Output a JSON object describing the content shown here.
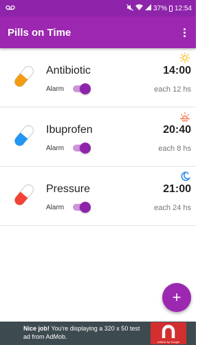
{
  "status_bar": {
    "left_icon": "voicemail-icon",
    "battery_percent": "37%",
    "time": "12:54"
  },
  "app_bar": {
    "title": "Pills on Time"
  },
  "pills": [
    {
      "name": "Antibiotic",
      "alarm_label": "Alarm",
      "alarm_on": true,
      "time": "14:00",
      "frequency": "each 12 hs",
      "period_icon": "sun-icon",
      "period_color": "#fbc02d",
      "pill_color": "#f39c12"
    },
    {
      "name": "Ibuprofen",
      "alarm_label": "Alarm",
      "alarm_on": true,
      "time": "20:40",
      "frequency": "each 8 hs",
      "period_icon": "sunset-icon",
      "period_color": "#ff7043",
      "pill_color": "#2196f3"
    },
    {
      "name": "Pressure",
      "alarm_label": "Alarm",
      "alarm_on": true,
      "time": "21:00",
      "frequency": "each 24 hs",
      "period_icon": "moon-icon",
      "period_color": "#1e88e5",
      "pill_color": "#f44336"
    }
  ],
  "fab": {
    "label": "+"
  },
  "ad": {
    "headline": "Nice job!",
    "body": " You're displaying a 320 x 50 test ad from AdMob.",
    "badge_caption": "AdMob by Google"
  },
  "colors": {
    "primary": "#9c27b0",
    "primary_dark": "#8e24aa",
    "toggle_track": "#ce93d8"
  }
}
